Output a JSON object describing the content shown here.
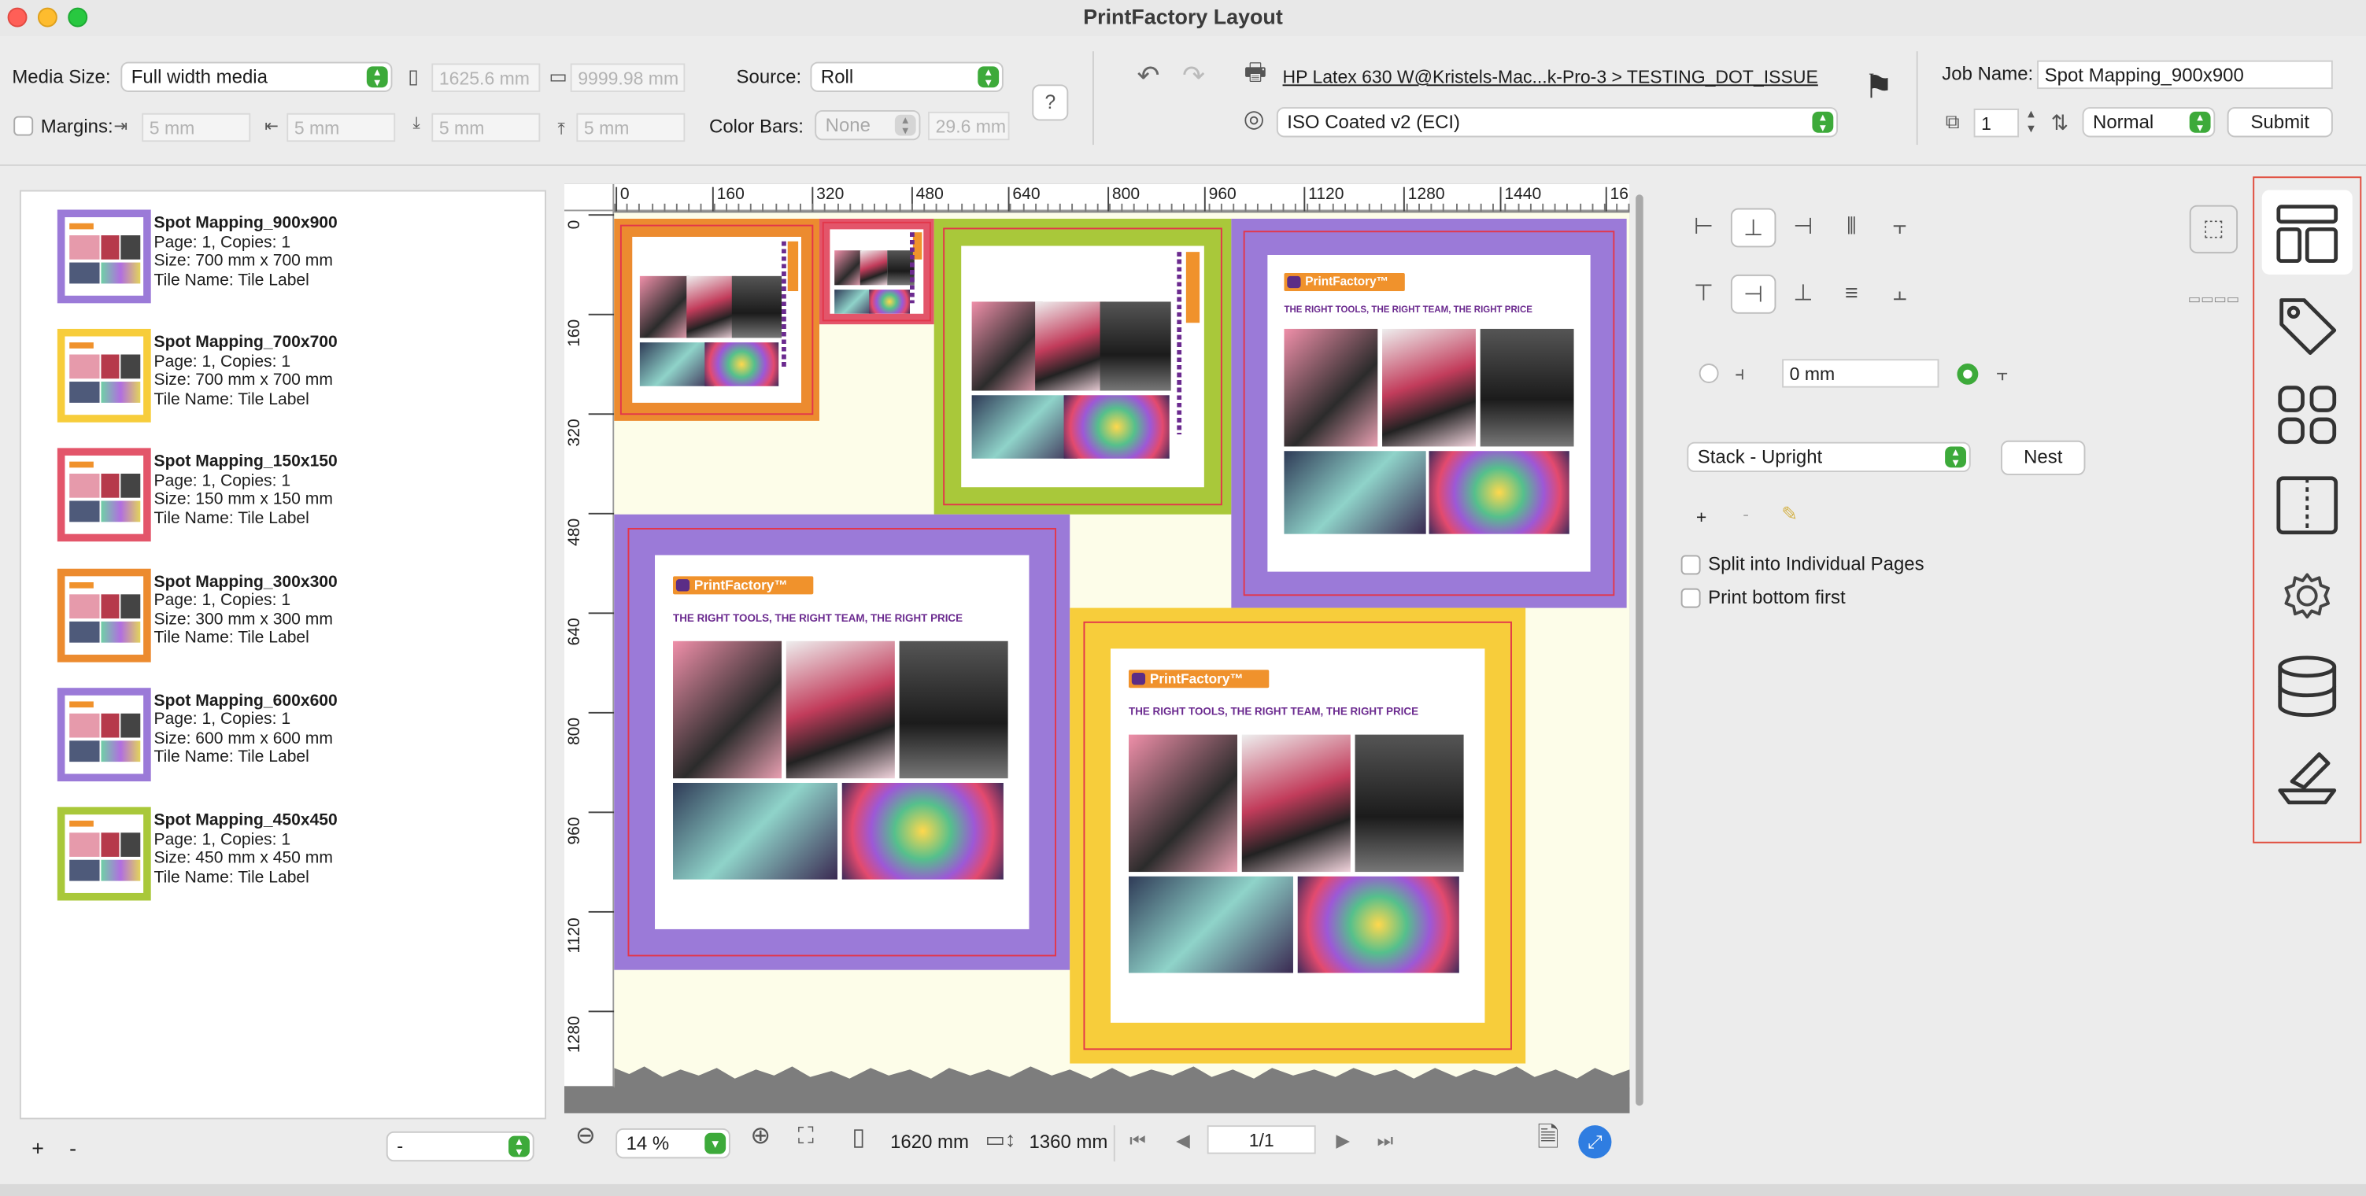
{
  "window": {
    "title": "PrintFactory Layout"
  },
  "toolbar": {
    "media_size_label": "Media Size:",
    "media_size_value": "Full width media",
    "media_width": "1625.6 mm",
    "media_height": "9999.98 mm",
    "margins_label": "Margins:",
    "margin_left": "5 mm",
    "margin_right": "5 mm",
    "margin_bottom": "5 mm",
    "margin_top": "5 mm",
    "source_label": "Source:",
    "source_value": "Roll",
    "color_bars_label": "Color Bars:",
    "color_bars_value": "None",
    "color_bars_size": "29.6 mm",
    "printer": "HP Latex 630 W@Kristels-Mac...k-Pro-3 > TESTING_DOT_ISSUE",
    "color_profile": "ISO Coated v2 (ECI)",
    "job_name_label": "Job Name:",
    "job_name_value": "Spot Mapping_900x900",
    "copies_value": "1",
    "priority_value": "Normal",
    "submit_label": "Submit"
  },
  "jobs": [
    {
      "name": "Spot Mapping_900x900",
      "pages": "Page: 1, Copies: 1",
      "size": "Size: 700 mm x 700 mm",
      "tile": "Tile Name: Tile Label",
      "color": "#9b7ad8"
    },
    {
      "name": "Spot Mapping_700x700",
      "pages": "Page: 1, Copies: 1",
      "size": "Size: 700 mm x 700 mm",
      "tile": "Tile Name: Tile Label",
      "color": "#f7cd3b"
    },
    {
      "name": "Spot Mapping_150x150",
      "pages": "Page: 1, Copies: 1",
      "size": "Size: 150 mm x 150 mm",
      "tile": "Tile Name: Tile Label",
      "color": "#e3556a"
    },
    {
      "name": "Spot Mapping_300x300",
      "pages": "Page: 1, Copies: 1",
      "size": "Size: 300 mm x 300 mm",
      "tile": "Tile Name: Tile Label",
      "color": "#ec8b2f"
    },
    {
      "name": "Spot Mapping_600x600",
      "pages": "Page: 1, Copies: 1",
      "size": "Size: 600 mm x 600 mm",
      "tile": "Tile Name: Tile Label",
      "color": "#9b7ad8"
    },
    {
      "name": "Spot Mapping_450x450",
      "pages": "Page: 1, Copies: 1",
      "size": "Size: 450 mm x 450 mm",
      "tile": "Tile Name: Tile Label",
      "color": "#a9c83a"
    }
  ],
  "left_footer": {
    "add": "+",
    "remove": "-",
    "select_value": "-"
  },
  "ruler": {
    "h_ticks": [
      "0",
      "160",
      "320",
      "480",
      "640",
      "800",
      "960",
      "1120",
      "1280",
      "1440",
      "16"
    ],
    "v_ticks": [
      "0",
      "160",
      "320",
      "480",
      "640",
      "800",
      "960",
      "1120",
      "1280"
    ]
  },
  "artwork": {
    "logo_text": "PrintFactory™",
    "tagline": "THE RIGHT TOOLS, THE RIGHT TEAM, THE RIGHT PRICE"
  },
  "bottom": {
    "zoom_value": "14 %",
    "width_value": "1620 mm",
    "height_value": "1360 mm",
    "page_value": "1/1"
  },
  "layout_panel": {
    "spacing_value": "0 mm",
    "arrangement_value": "Stack - Upright",
    "nest_label": "Nest",
    "add": "+",
    "remove": "-",
    "split_label": "Split into Individual Pages",
    "print_bottom_label": "Print bottom first"
  },
  "sidebar": {
    "icons": [
      "layout-icon",
      "tag-icon",
      "grid-icon",
      "split-page-icon",
      "gear-icon",
      "database-icon",
      "cutter-icon"
    ]
  }
}
